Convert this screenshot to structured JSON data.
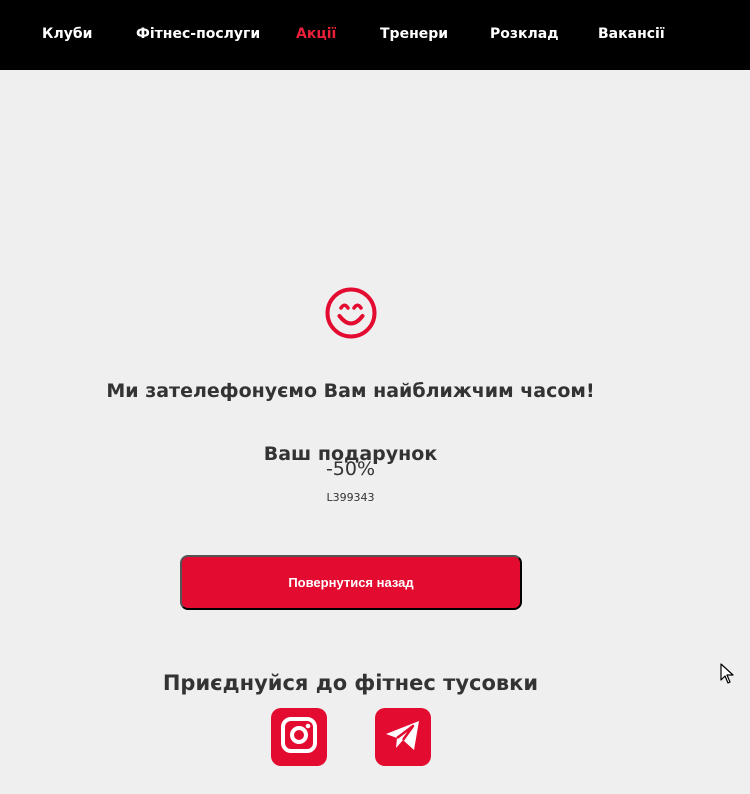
{
  "nav": {
    "items": [
      {
        "label": "Клуби"
      },
      {
        "label": "Фітнес-послуги"
      },
      {
        "label": "Акції"
      },
      {
        "label": "Тренери"
      },
      {
        "label": "Розклад"
      },
      {
        "label": "Вакансії"
      }
    ],
    "active_item": "Акції"
  },
  "confirmation": {
    "icon": "smile-icon",
    "title": "Ми зателефонуємо Вам найближчим часом!"
  },
  "gift": {
    "title": "Ваш подарунок",
    "value": "-50%",
    "code": "L399343"
  },
  "actions": {
    "back_label": "Повернутися назад"
  },
  "community": {
    "title": "Приєднуйся до фітнес тусовки",
    "icons": [
      "instagram-icon",
      "telegram-icon"
    ]
  },
  "colors": {
    "nav_background": "#000000",
    "accent": "#e30b2f",
    "page_background": "#efefef",
    "text": "#333333"
  }
}
